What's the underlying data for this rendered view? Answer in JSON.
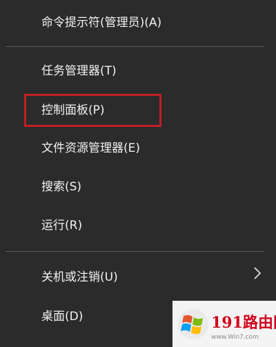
{
  "menu": {
    "items": [
      {
        "label": "命令提示符(管理员)(A)"
      },
      {
        "label": "任务管理器(T)"
      },
      {
        "label": "控制面板(P)"
      },
      {
        "label": "文件资源管理器(E)"
      },
      {
        "label": "搜索(S)"
      },
      {
        "label": "运行(R)"
      },
      {
        "label": "关机或注销(U)",
        "has_submenu": true
      },
      {
        "label": "桌面(D)"
      }
    ],
    "highlighted_item": "控制面板(P)",
    "highlight_color": "#c41e24"
  },
  "watermark": {
    "title_prefix": "191",
    "title_suffix": "路由网",
    "subtitle": "www.Win7.com",
    "logo_icon": "windows-logo-icon"
  },
  "colors": {
    "background": "#2b2b2b",
    "text": "#f2f2f2",
    "separator": "#5a5a5a"
  }
}
